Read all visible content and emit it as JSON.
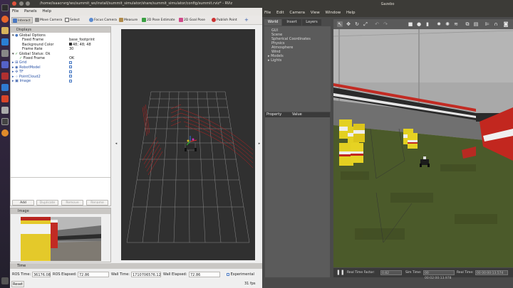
{
  "rviz": {
    "title": "/home/isaacrvrg/ws/summit_ws/install/summit_simulator/share/summit_simulator/config/summit.rviz* - RViz",
    "menu": [
      "File",
      "Panels",
      "Help"
    ],
    "toolbar": [
      "Interact",
      "Move Camera",
      "Select",
      "Focus Camera",
      "Measure",
      "2D Pose Estimate",
      "2D Goal Pose",
      "Publish Point"
    ],
    "displays": {
      "title": "Displays",
      "rows": [
        {
          "label": "Global Options",
          "value": ""
        },
        {
          "label": "Fixed Frame",
          "value": "base_footprint"
        },
        {
          "label": "Background Color",
          "value": "48; 48; 48"
        },
        {
          "label": "Frame Rate",
          "value": "30"
        },
        {
          "label": "Global Status: Ok",
          "value": ""
        },
        {
          "label": "Fixed Frame",
          "value": "OK"
        },
        {
          "label": "Grid",
          "value": ""
        },
        {
          "label": "RobotModel",
          "value": ""
        },
        {
          "label": "TF",
          "value": ""
        },
        {
          "label": "PointCloud2",
          "value": ""
        },
        {
          "label": "Image",
          "value": ""
        }
      ],
      "buttons": [
        "Add",
        "Duplicate",
        "Remove",
        "Rename"
      ]
    },
    "image_panel": {
      "title": "Image"
    },
    "time": {
      "title": "Time",
      "ros_time_label": "ROS Time:",
      "ros_time": "36176.08",
      "ros_elapsed_label": "ROS Elapsed:",
      "ros_elapsed": "72.86",
      "wall_time_label": "Wall Time:",
      "wall_time": "1710706576.12",
      "wall_elapsed_label": "Wall Elapsed:",
      "wall_elapsed": "72.86",
      "experimental_label": "Experimental",
      "reset_label": "Reset",
      "fps": "31 fps"
    }
  },
  "gazebo": {
    "title": "Gazebo",
    "menu": [
      "File",
      "Edit",
      "Camera",
      "View",
      "Window",
      "Help"
    ],
    "tabs": [
      "World",
      "Insert",
      "Layers"
    ],
    "tree": [
      "GUI",
      "Scene",
      "Spherical Coordinates",
      "Physics",
      "Atmosphere",
      "Wind",
      "Models",
      "Lights"
    ],
    "property_label": "Property",
    "value_label": "Value",
    "status": {
      "rtf_label": "Real Time Factor:",
      "rtf": "0.82",
      "sim_time_label": "Sim Time:",
      "sim_time": "00 00:02:00:13.978",
      "real_time_label": "Real Time:",
      "real_time": "00 00:00:13.574"
    }
  },
  "colors": {
    "viewport_bg": "#303030",
    "pointcloud": "#c0201f",
    "grass": "#4b5a2a",
    "barrel_yellow": "#e3d021"
  }
}
